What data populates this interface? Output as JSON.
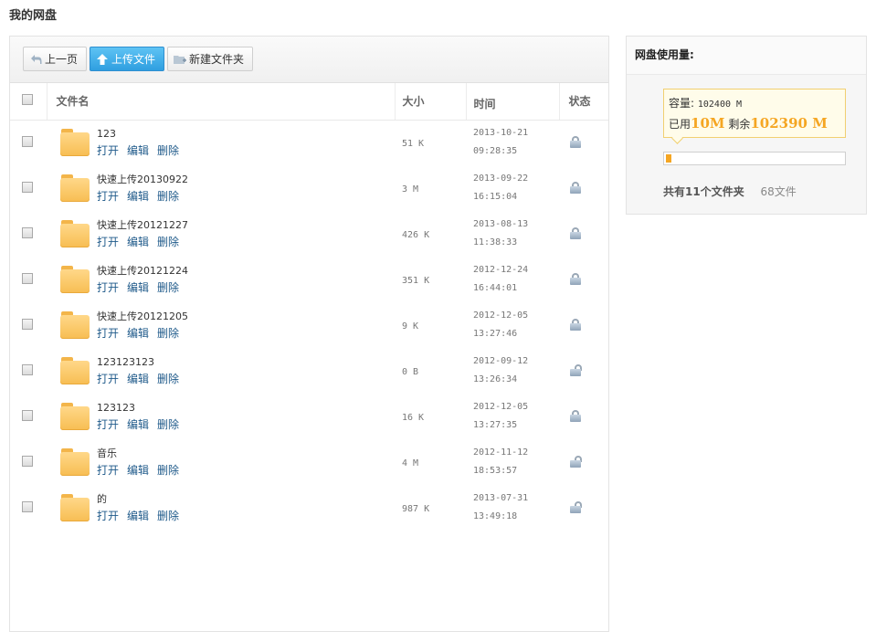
{
  "page": {
    "title": "我的网盘"
  },
  "toolbar": {
    "back_label": "上一页",
    "upload_label": "上传文件",
    "new_folder_label": "新建文件夹"
  },
  "table": {
    "headers": {
      "name": "文件名",
      "size": "大小",
      "time": "时间",
      "status": "状态"
    },
    "rows": [
      {
        "name": "123",
        "size": "51 K",
        "date": "2013-10-21",
        "clock": "09:28:35",
        "status": "locked"
      },
      {
        "name": "快速上传20130922",
        "size": "3 M",
        "date": "2013-09-22",
        "clock": "16:15:04",
        "status": "locked"
      },
      {
        "name": "快速上传20121227",
        "size": "426 K",
        "date": "2013-08-13",
        "clock": "11:38:33",
        "status": "locked"
      },
      {
        "name": "快速上传20121224",
        "size": "351 K",
        "date": "2012-12-24",
        "clock": "16:44:01",
        "status": "locked"
      },
      {
        "name": "快速上传20121205",
        "size": "9 K",
        "date": "2012-12-05",
        "clock": "13:27:46",
        "status": "locked"
      },
      {
        "name": "123123123",
        "size": "0 B",
        "date": "2012-09-12",
        "clock": "13:26:34",
        "status": "unlocked"
      },
      {
        "name": "123123",
        "size": "16 K",
        "date": "2012-12-05",
        "clock": "13:27:35",
        "status": "locked"
      },
      {
        "name": "音乐",
        "size": "4 M",
        "date": "2012-11-12",
        "clock": "18:53:57",
        "status": "unlocked"
      },
      {
        "name": "的",
        "size": "987 K",
        "date": "2013-07-31",
        "clock": "13:49:18",
        "status": "unlocked"
      }
    ],
    "actions": {
      "open": "打开",
      "edit": "编辑",
      "delete": "删除"
    }
  },
  "side": {
    "title": "网盘使用量:",
    "capacity_label": "容量:",
    "capacity_value": "102400 M",
    "used_label": "已用",
    "used_value": "10M",
    "remaining_label": "剩余",
    "remaining_value": "102390 M",
    "usage_fraction": 0.0001,
    "folders_summary": "共有11个文件夹",
    "files_summary": "68文件"
  },
  "colors": {
    "accent": "#f5a623",
    "upload_button": "#2f9fe0",
    "link": "#1f5a8a"
  }
}
